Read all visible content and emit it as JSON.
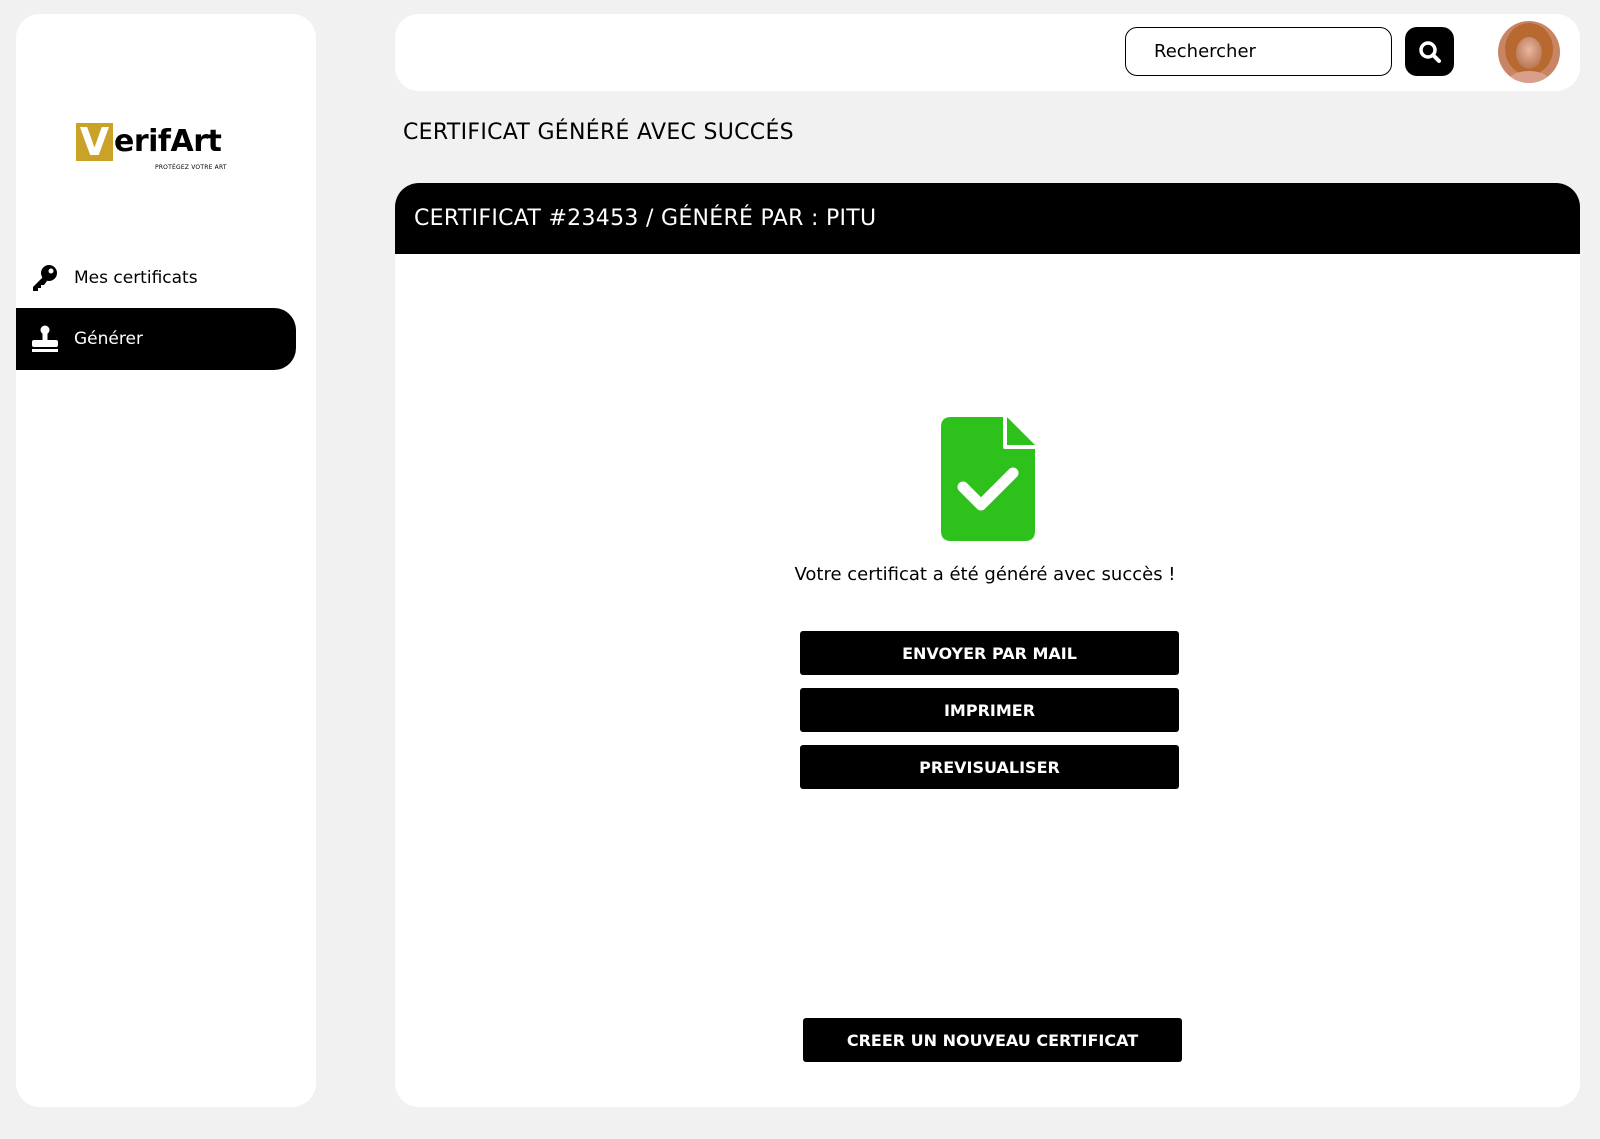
{
  "brand": {
    "logo_letter": "V",
    "logo_rest": "erifArt",
    "tagline": "PROTÉGEZ VOTRE ART",
    "accent_color": "#c9a227"
  },
  "sidebar": {
    "items": [
      {
        "label": "Mes certificats",
        "icon": "key-icon",
        "active": false
      },
      {
        "label": "Générer",
        "icon": "stamp-icon",
        "active": true
      }
    ]
  },
  "header": {
    "search": {
      "placeholder": "Rechercher",
      "value": ""
    },
    "search_icon": "search-icon",
    "avatar": "user-avatar"
  },
  "page": {
    "title": "CERTIFICAT GÉNÉRÉ AVEC SUCCÉS"
  },
  "card": {
    "header": "CERTIFICAT #23453 / GÉNÉRÉ PAR : PITU",
    "success_icon": "file-check-icon",
    "success_color": "#2ec01b",
    "message": "Votre certificat a été généré avec succès !",
    "actions": [
      {
        "label": "ENVOYER PAR MAIL"
      },
      {
        "label": "IMPRIMER"
      },
      {
        "label": "PREVISUALISER"
      }
    ],
    "new_certificate_label": "CREER UN NOUVEAU CERTIFICAT"
  }
}
